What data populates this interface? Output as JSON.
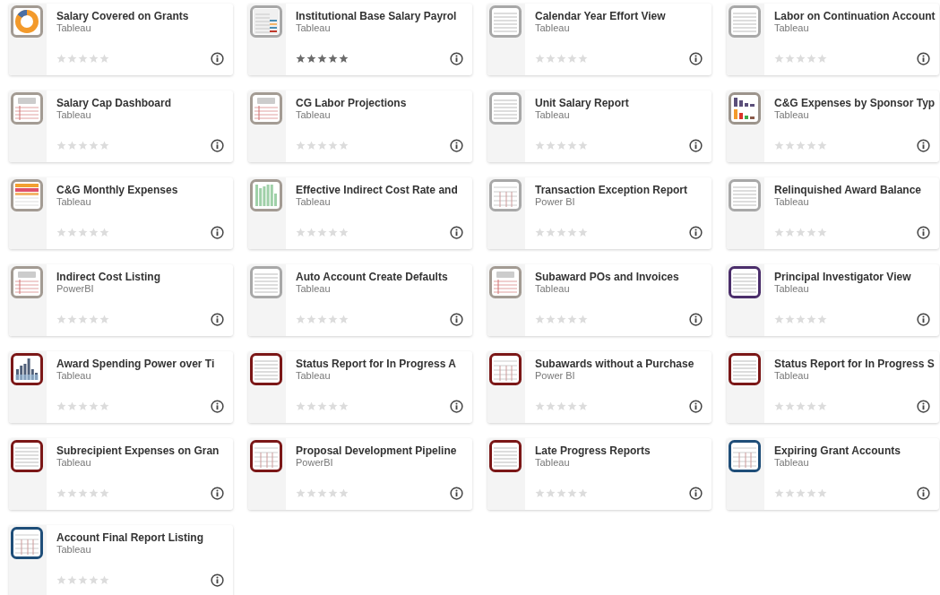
{
  "items": [
    {
      "title": "Salary Covered on Grants",
      "source": "Tableau",
      "stars": 0,
      "kind": "donut",
      "color": "#a39b93"
    },
    {
      "title": "Institutional Base Salary Payrol",
      "source": "Tableau",
      "stars": 5,
      "kind": "report",
      "color": "#a8a8a8"
    },
    {
      "title": "Calendar Year Effort View",
      "source": "Tableau",
      "stars": 0,
      "kind": "lines",
      "color": "#a8a8a8"
    },
    {
      "title": "Labor on Continuation Account",
      "source": "Tableau",
      "stars": 0,
      "kind": "lines",
      "color": "#a8a8a8"
    },
    {
      "title": "Salary Cap Dashboard",
      "source": "Tableau",
      "stars": 0,
      "kind": "ora",
      "color": "#a39b93"
    },
    {
      "title": "CG Labor Projections",
      "source": "Tableau",
      "stars": 0,
      "kind": "ora",
      "color": "#a39b93"
    },
    {
      "title": "Unit Salary Report",
      "source": "Tableau",
      "stars": 0,
      "kind": "lines",
      "color": "#a8a8a8"
    },
    {
      "title": "C&G Expenses by Sponsor Typ",
      "source": "Tableau",
      "stars": 0,
      "kind": "bars",
      "color": "#9c948c"
    },
    {
      "title": "C&G Monthly Expenses",
      "source": "Tableau",
      "stars": 0,
      "kind": "heatmap",
      "color": "#a39b93"
    },
    {
      "title": "Effective Indirect Cost Rate and",
      "source": "Tableau",
      "stars": 0,
      "kind": "columns",
      "color": "#a39b93"
    },
    {
      "title": "Transaction Exception Report",
      "source": "Power BI",
      "stars": 0,
      "kind": "grid",
      "color": "#a8a8a8"
    },
    {
      "title": "Relinquished Award Balance",
      "source": "Tableau",
      "stars": 0,
      "kind": "lines",
      "color": "#a8a8a8"
    },
    {
      "title": "Indirect Cost Listing",
      "source": "PowerBI",
      "stars": 0,
      "kind": "ora",
      "color": "#a39b93"
    },
    {
      "title": "Auto Account Create Defaults",
      "source": "Tableau",
      "stars": 0,
      "kind": "lines",
      "color": "#a8a8a8"
    },
    {
      "title": "Subaward POs and Invoices",
      "source": "Tableau",
      "stars": 0,
      "kind": "ora",
      "color": "#a39b93"
    },
    {
      "title": "Principal Investigator View",
      "source": "Tableau",
      "stars": 0,
      "kind": "lines",
      "color": "#4b2e6b"
    },
    {
      "title": "Award Spending Power over Ti",
      "source": "Tableau",
      "stars": 0,
      "kind": "spend",
      "color": "#7b1717"
    },
    {
      "title": "Status Report for In Progress A",
      "source": "Tableau",
      "stars": 0,
      "kind": "lines",
      "color": "#7b1717"
    },
    {
      "title": "Subawards without a Purchase",
      "source": "Power BI",
      "stars": 0,
      "kind": "grid",
      "color": "#7b1717"
    },
    {
      "title": "Status Report for In Progress S",
      "source": "Tableau",
      "stars": 0,
      "kind": "lines",
      "color": "#7b1717"
    },
    {
      "title": "Subrecipient Expenses on Gran",
      "source": "Tableau",
      "stars": 0,
      "kind": "lines",
      "color": "#7b1717"
    },
    {
      "title": "Proposal Development Pipeline",
      "source": "PowerBI",
      "stars": 0,
      "kind": "grid",
      "color": "#7b1717"
    },
    {
      "title": "Late Progress Reports",
      "source": "Tableau",
      "stars": 0,
      "kind": "lines",
      "color": "#7b1717"
    },
    {
      "title": "Expiring Grant Accounts",
      "source": "Tableau",
      "stars": 0,
      "kind": "grid",
      "color": "#1f4e79"
    },
    {
      "title": "Account Final Report Listing",
      "source": "Tableau",
      "stars": 0,
      "kind": "grid",
      "color": "#1f4e79"
    }
  ]
}
